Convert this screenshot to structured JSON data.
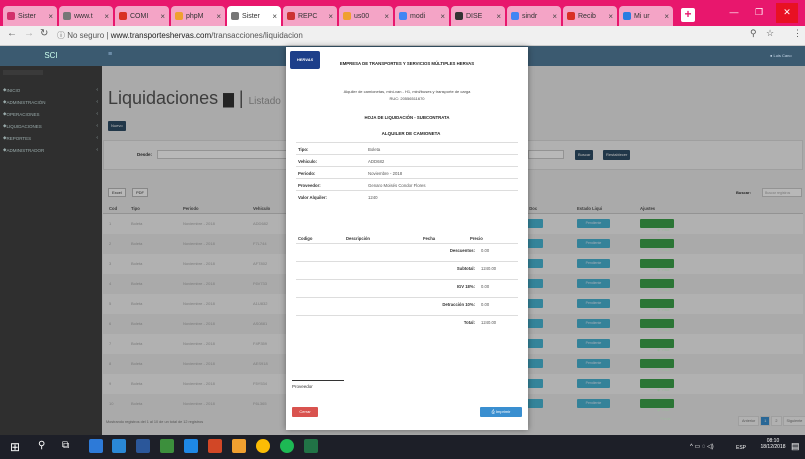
{
  "browser": {
    "tabs": [
      {
        "label": "Sister",
        "color": "#d22f6b"
      },
      {
        "label": "www.t",
        "color": "#777777"
      },
      {
        "label": "COMI",
        "color": "#d93025"
      },
      {
        "label": "phpM",
        "color": "#f0a030"
      },
      {
        "label": "Sister",
        "color": "#777777"
      },
      {
        "label": "REPC",
        "color": "#cc3333"
      },
      {
        "label": "us00",
        "color": "#f0a030"
      },
      {
        "label": "modi",
        "color": "#4285f4"
      },
      {
        "label": "DISE",
        "color": "#333333"
      },
      {
        "label": "sindr",
        "color": "#4285f4"
      },
      {
        "label": "Recib",
        "color": "#d93025"
      },
      {
        "label": "Mi ur",
        "color": "#2a7de1"
      }
    ],
    "security": "No seguro",
    "url_host": "www.transporteshervas.com",
    "url_path": "/transacciones/liquidacion"
  },
  "app": {
    "brand": "SCI",
    "user": "Luis Cano",
    "sidebar": [
      {
        "label": "INICIO"
      },
      {
        "label": "ADMINISTRACIÓN"
      },
      {
        "label": "OPERACIONES"
      },
      {
        "label": "LIQUIDACIONES"
      },
      {
        "label": "REPORTES"
      },
      {
        "label": "ADMINISTRADOR"
      }
    ],
    "page_title": "Liquidaciones",
    "page_subtitle": "Listado",
    "new_button": "Nuevo",
    "date_label": "Desde:",
    "search_button": "Buscar",
    "reset_button": "Restablecer",
    "export_excel": "Excel",
    "export_pdf": "PDF",
    "search_label": "Buscar:",
    "search_placeholder": "Buscar registros",
    "columns": [
      "Cod",
      "Tipo",
      "Periodo",
      "Vehiculo",
      "Pdte Doc",
      "Estado Liqui",
      "Ajustes"
    ],
    "rows": [
      {
        "cod": "1",
        "tipo": "Boleta",
        "periodo": "Noviembre - 2018",
        "vehiculo": "ADD682"
      },
      {
        "cod": "2",
        "tipo": "Boleta",
        "periodo": "Noviembre - 2018",
        "vehiculo": "F7L744"
      },
      {
        "cod": "3",
        "tipo": "Boleta",
        "periodo": "Noviembre - 2018",
        "vehiculo": "AFT802"
      },
      {
        "cod": "4",
        "tipo": "Boleta",
        "periodo": "Noviembre - 2018",
        "vehiculo": "F6V733"
      },
      {
        "cod": "5",
        "tipo": "Boleta",
        "periodo": "Noviembre - 2018",
        "vehiculo": "A1U832"
      },
      {
        "cod": "6",
        "tipo": "Boleta",
        "periodo": "Noviembre - 2018",
        "vehiculo": "AS0881"
      },
      {
        "cod": "7",
        "tipo": "Boleta",
        "periodo": "Noviembre - 2018",
        "vehiculo": "F4P359"
      },
      {
        "cod": "8",
        "tipo": "Boleta",
        "periodo": "Noviembre - 2018",
        "vehiculo": "AES918"
      },
      {
        "cod": "9",
        "tipo": "Boleta",
        "periodo": "Noviembre - 2018",
        "vehiculo": "F5Y534"
      },
      {
        "cod": "10",
        "tipo": "Boleta",
        "periodo": "Noviembre - 2018",
        "vehiculo": "F6L365"
      }
    ],
    "status_label": "Pendiente",
    "view_label": "Vista Previa",
    "footer_info": "Mostrando registros del 1 al 10 de un total de 12 registros",
    "pager": [
      "Anterior",
      "1",
      "2",
      "Siguiente"
    ]
  },
  "modal": {
    "logo_text": "HERVAS",
    "company": "EMPRESA DE TRANSPORTES Y SERVICIOS MÚLTIPLES HERVAS",
    "tagline": "Alquiler de camionetas, mini-van - H1, mini/buses y transporte de carga",
    "ruc": "RUC: 20556511670",
    "doc_title": "HOJA DE LIQUIDACIÓN - SUBCONTRATA",
    "section_title": "ALQUILER DE CAMIONETA",
    "fields": [
      {
        "key": "Tipo:",
        "value": "Boleta"
      },
      {
        "key": "Vehiculo:",
        "value": "ADD682"
      },
      {
        "key": "Periodo:",
        "value": "Noviembre - 2018"
      },
      {
        "key": "Proveedor:",
        "value": "Genaro Moisés Condor Flores"
      },
      {
        "key": "Valor Alquiler:",
        "value": "1240"
      }
    ],
    "table_headers": [
      "Codigo",
      "Descripción",
      "Fecha",
      "Precio"
    ],
    "totals": [
      {
        "label": "Descuentos:",
        "value": "0.00"
      },
      {
        "label": "Subtotal:",
        "value": "1240.00"
      },
      {
        "label": "IGV 18%:",
        "value": "0.00"
      },
      {
        "label": "Detracción 10%:",
        "value": "0.00"
      },
      {
        "label": "Total:",
        "value": "1240.00"
      }
    ],
    "signature_label": "Proveedor",
    "close_button": "Cerrar",
    "print_button": "Imprimir"
  },
  "taskbar": {
    "lang": "ESP",
    "time": "08:10",
    "date": "18/12/2018"
  }
}
